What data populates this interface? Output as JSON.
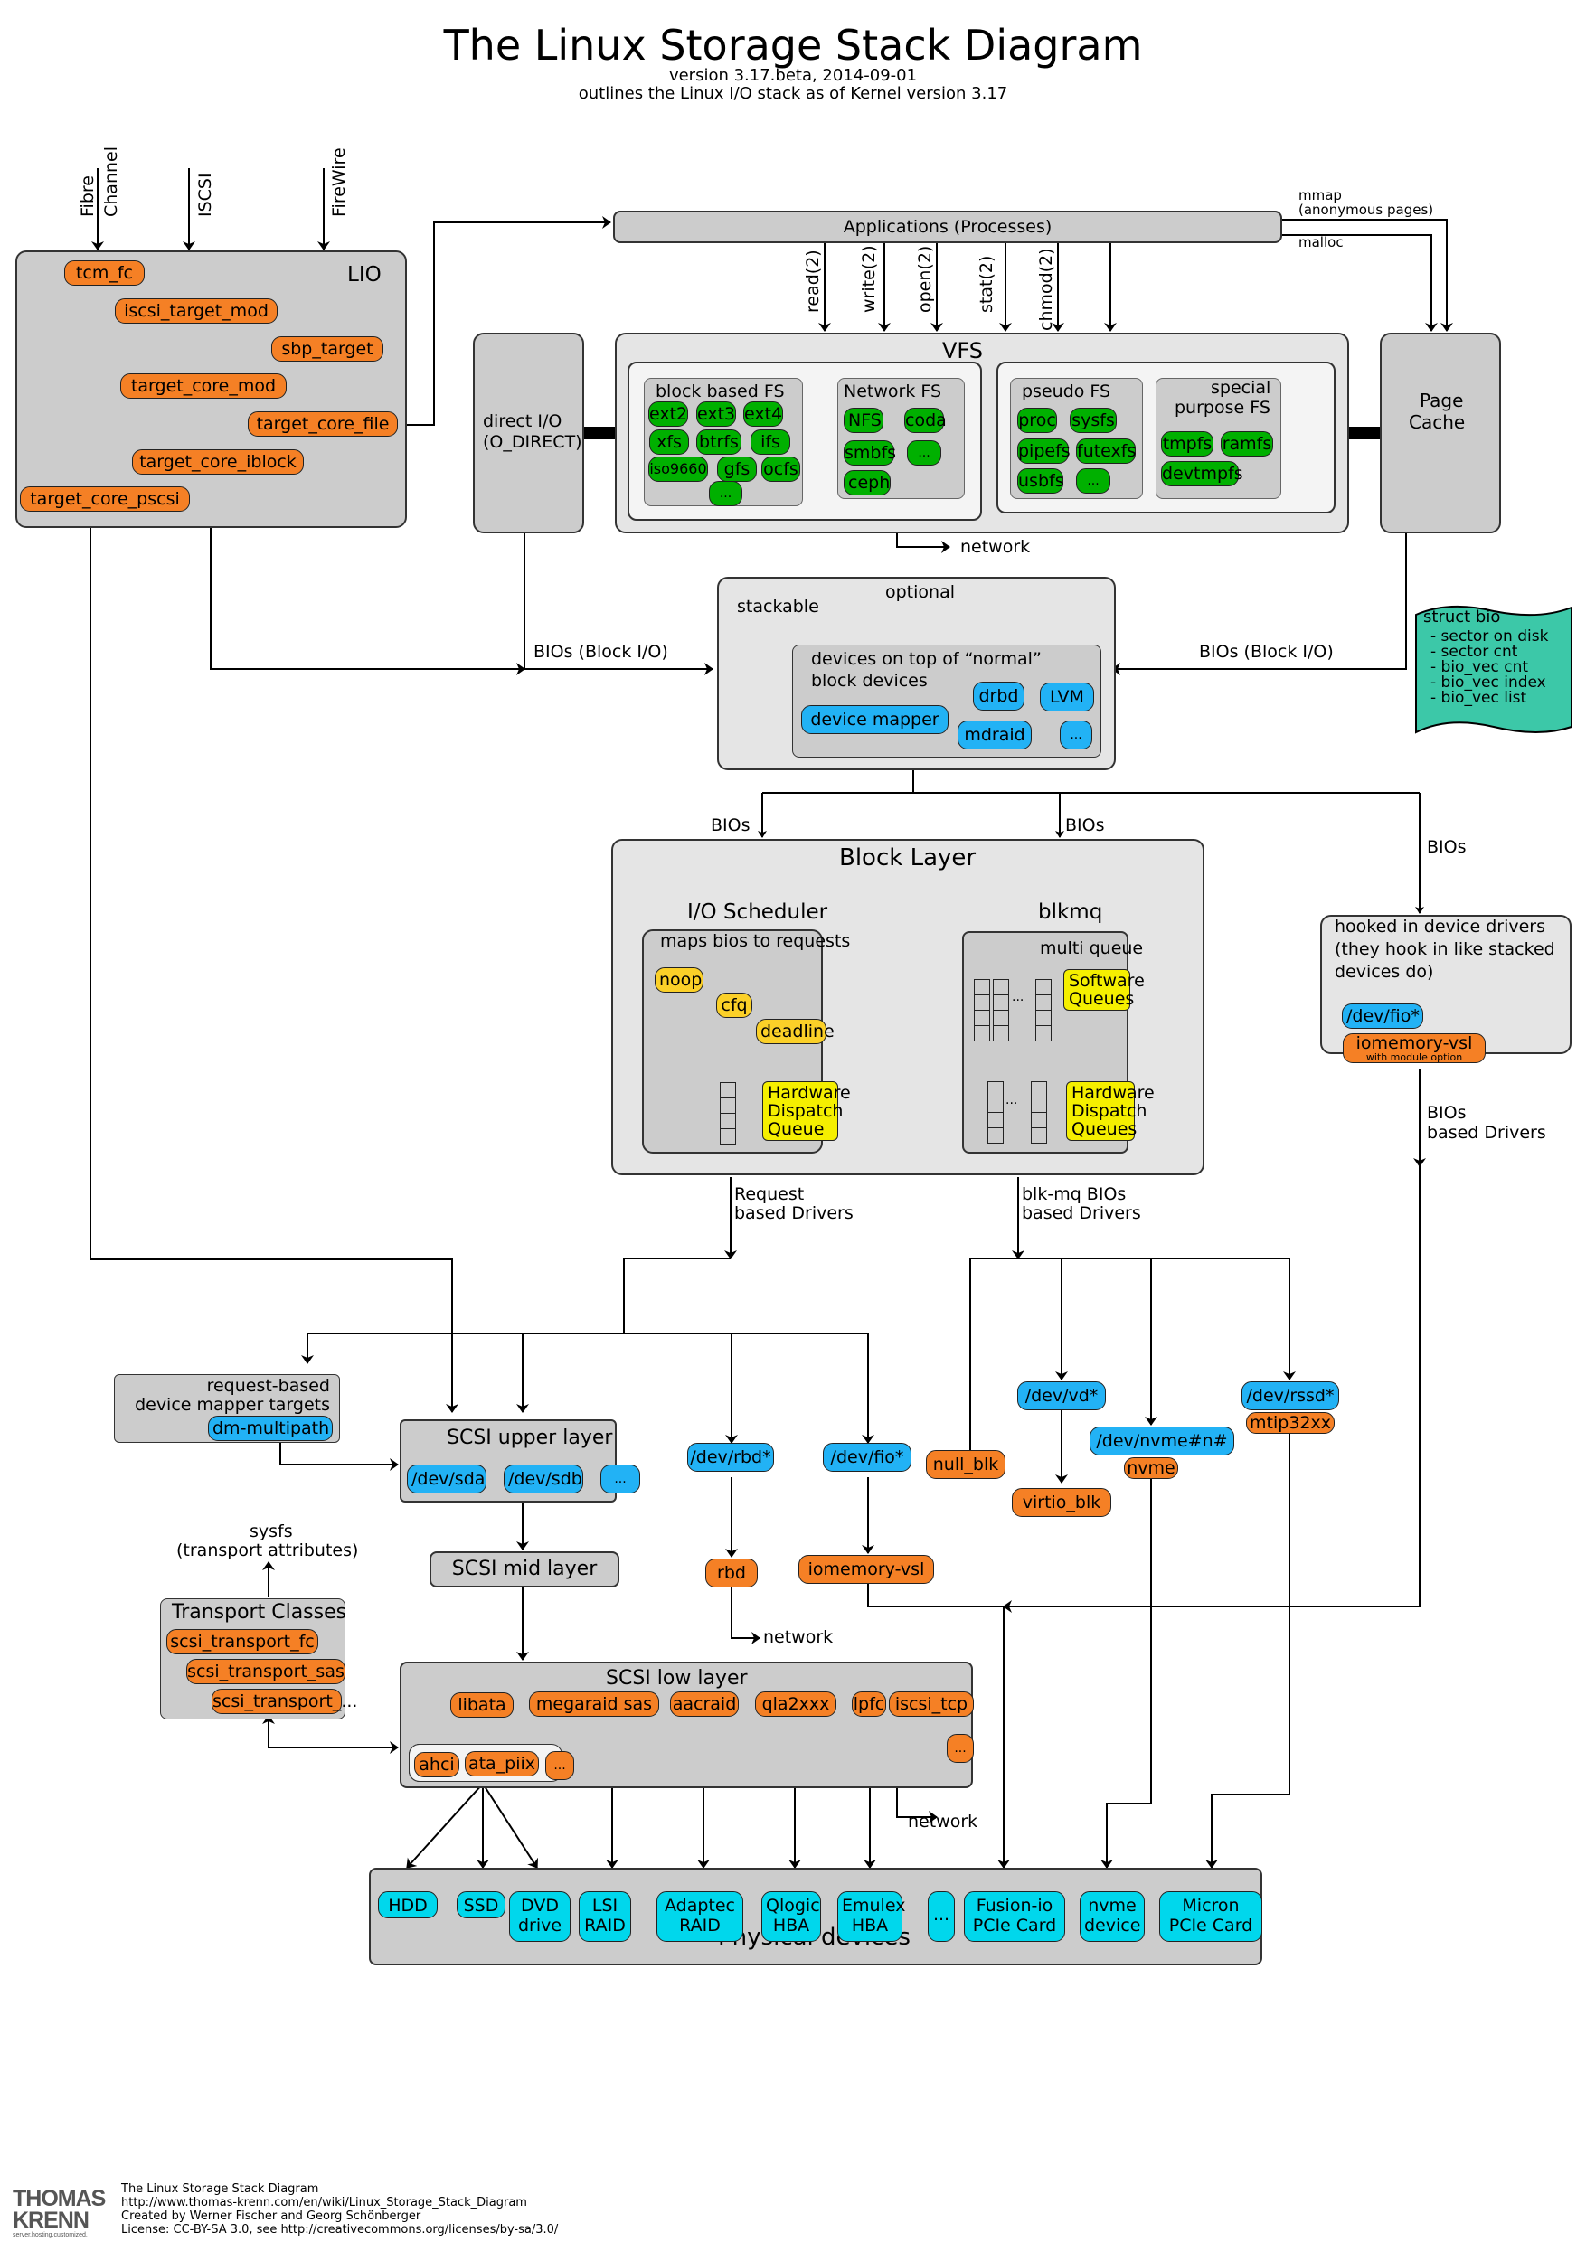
{
  "header": {
    "title": "The Linux Storage Stack Diagram",
    "version": "version 3.17.beta, 2014-09-01",
    "subtitle": "outlines the Linux I/O stack as of Kernel version 3.17"
  },
  "inputs": {
    "fibre": "Fibre",
    "channel": "Channel",
    "iscsi": "ISCSI",
    "firewire": "FireWire"
  },
  "lio": {
    "title": "LIO",
    "modules": [
      "tcm_fc",
      "iscsi_target_mod",
      "sbp_target",
      "target_core_mod",
      "target_core_file",
      "target_core_iblock",
      "target_core_pscsi"
    ]
  },
  "applications": {
    "label": "Applications (Processes)",
    "mmap": "mmap",
    "anon": "(anonymous pages)",
    "malloc": "malloc",
    "syscalls": [
      "read(2)",
      "write(2)",
      "open(2)",
      "stat(2)",
      "chmod(2)",
      "..."
    ]
  },
  "direct_io": {
    "line1": "direct I/O",
    "line2": "(O_DIRECT)"
  },
  "page_cache": {
    "line1": "Page",
    "line2": "Cache"
  },
  "vfs": {
    "title": "VFS",
    "block_fs": {
      "title": "block based FS",
      "items": [
        "ext2",
        "ext3",
        "ext4",
        "xfs",
        "btrfs",
        "ifs",
        "iso9660",
        "gfs",
        "ocfs",
        "..."
      ]
    },
    "network_fs": {
      "title": "Network FS",
      "items": [
        "NFS",
        "coda",
        "smbfs",
        "...",
        "ceph"
      ]
    },
    "pseudo_fs": {
      "title": "pseudo FS",
      "items": [
        "proc",
        "sysfs",
        "pipefs",
        "futexfs",
        "usbfs",
        "..."
      ]
    },
    "special_fs": {
      "title1": "special",
      "title2": "purpose FS",
      "items": [
        "tmpfs",
        "ramfs",
        "devtmpfs"
      ]
    },
    "network_label": "network"
  },
  "optional": {
    "title": "optional",
    "stackable": "stackable",
    "inner1": "devices on top of “normal”",
    "inner2": "block devices",
    "items": [
      "device mapper",
      "drbd",
      "LVM",
      "mdraid",
      "..."
    ],
    "bios_left": "BIOs (Block I/O)",
    "bios_right": "BIOs (Block I/O)"
  },
  "struct_bio": {
    "title": "struct bio",
    "fields": [
      "- sector on disk",
      "- sector cnt",
      "- bio_vec cnt",
      "- bio_vec index",
      "- bio_vec list"
    ],
    "color": "#3cc8a8"
  },
  "block_layer": {
    "title": "Block Layer",
    "bios_label": "BIOs",
    "io_scheduler": {
      "title": "I/O Scheduler",
      "sub": "maps bios to requests",
      "schedulers": [
        "noop",
        "cfq",
        "deadline"
      ],
      "hw1": "Hardware",
      "hw2": "Dispatch",
      "hw3": "Queue"
    },
    "blkmq": {
      "title": "blkmq",
      "sub": "multi queue",
      "sw1": "Software",
      "sw2": "Queues",
      "hw1": "Hardware",
      "hw2": "Dispatch",
      "hw3": "Queues",
      "dots": "..."
    }
  },
  "hooked": {
    "bios": "BIOs",
    "line1": "hooked in device drivers",
    "line2": "(they hook in like stacked",
    "line3": "devices do)",
    "dev": "/dev/fio*",
    "driver": "iomemory-vsl",
    "driver_note": "with module option",
    "bios_drivers1": "BIOs",
    "bios_drivers2": "based Drivers"
  },
  "drivers": {
    "request1": "Request",
    "request2": "based Drivers",
    "blkmq1": "blk-mq BIOs",
    "blkmq2": "based Drivers"
  },
  "dm_targets": {
    "line1": "request-based",
    "line2": "device mapper targets",
    "item": "dm-multipath"
  },
  "scsi_upper": {
    "title": "SCSI upper layer",
    "items": [
      "/dev/sda",
      "/dev/sdb",
      "..."
    ]
  },
  "scsi_mid": {
    "title": "SCSI mid layer"
  },
  "sysfs": {
    "line1": "sysfs",
    "line2": "(transport attributes)"
  },
  "transport": {
    "title": "Transport Classes",
    "items": [
      "scsi_transport_fc",
      "scsi_transport_sas",
      "scsi_transport_..."
    ]
  },
  "scsi_low": {
    "title": "SCSI low layer",
    "items": [
      "libata",
      "megaraid sas",
      "aacraid",
      "qla2xxx",
      "lpfc",
      "iscsi_tcp",
      "..."
    ],
    "ata": [
      "ahci",
      "ata_piix",
      "..."
    ],
    "network": "network"
  },
  "block_devs": {
    "rbd_dev": "/dev/rbd*",
    "rbd": "rbd",
    "rbd_network": "network",
    "fio_dev": "/dev/fio*",
    "iomemory": "iomemory-vsl",
    "null_blk": "null_blk",
    "vd_dev": "/dev/vd*",
    "virtio": "virtio_blk",
    "nvme_dev": "/dev/nvme#n#",
    "nvme": "nvme",
    "rssd_dev": "/dev/rssd*",
    "mtip": "mtip32xx"
  },
  "physical": {
    "title": "Physical devices",
    "devices": [
      [
        "HDD"
      ],
      [
        "SSD"
      ],
      [
        "DVD",
        "drive"
      ],
      [
        "LSI",
        "RAID"
      ],
      [
        "Adaptec",
        "RAID"
      ],
      [
        "Qlogic",
        "HBA"
      ],
      [
        "Emulex",
        "HBA"
      ],
      [
        "..."
      ],
      [
        "Fusion-io",
        "PCIe Card"
      ],
      [
        "nvme",
        "device"
      ],
      [
        "Micron",
        "PCIe Card"
      ]
    ]
  },
  "footer": {
    "logo1": "THOMAS",
    "logo2": "KRENN",
    "tagline": "server.hosting.customized.",
    "line1": "The Linux Storage Stack Diagram",
    "line2": "http://www.thomas-krenn.com/en/wiki/Linux_Storage_Stack_Diagram",
    "line3": "Created by Werner Fischer and Georg Schönberger",
    "line4": "License: CC-BY-SA 3.0, see http://creativecommons.org/licenses/by-sa/3.0/"
  }
}
